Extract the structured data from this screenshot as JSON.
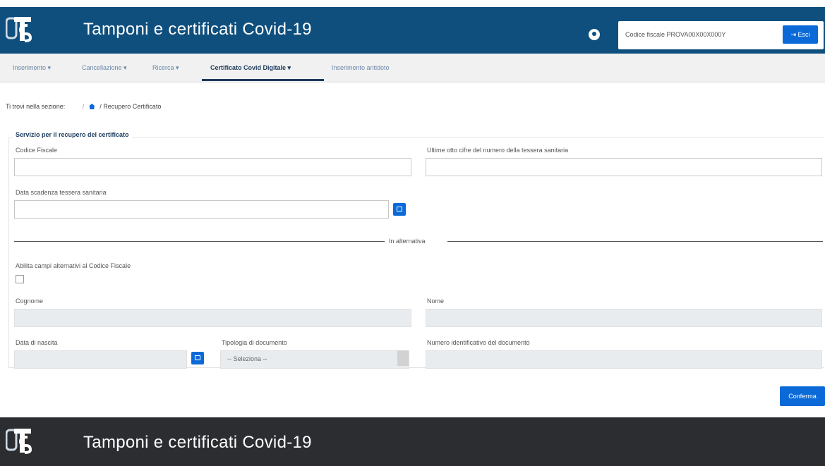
{
  "header": {
    "title": "Tamponi e certificati Covid-19",
    "cf_label": "Codice fiscale PROVA00X00X000Y",
    "exit_label": "Esci",
    "colors": {
      "header_bg": "#0f4f7e",
      "accent": "#0b6ad8",
      "footer_bg": "#2b2d31"
    }
  },
  "nav": {
    "items": [
      {
        "label": "Inserimento ▾"
      },
      {
        "label": "Cancellazione ▾"
      },
      {
        "label": "Ricerca ▾"
      },
      {
        "label": "Certificato Covid Digitale ▾"
      },
      {
        "label": "Inserimento antidoto"
      }
    ]
  },
  "breadcrumb": {
    "prefix": "Ti trovi nella sezione:",
    "current": "/ Recupero Certificato"
  },
  "form": {
    "legend": "Servizio per il recupero del certificato",
    "codice_fiscale_label": "Codice Fiscale",
    "tessera_label": "Ultime otto cifre del numero della tessera sanitaria",
    "scadenza_label": "Data scadenza tessera sanitaria",
    "alternative_text": "In alternativa",
    "abilita_label": "Abilita campi alternativi al Codice Fiscale",
    "cognome_label": "Cognome",
    "nome_label": "Nome",
    "data_nascita_label": "Data di nascita",
    "tipologia_label": "Tipologia di documento",
    "tipologia_value": "-- Seleziona --",
    "numero_doc_label": "Numero identificativo del documento",
    "confirm_label": "Conferma"
  },
  "footer": {
    "title": "Tamponi e certificati Covid-19"
  }
}
